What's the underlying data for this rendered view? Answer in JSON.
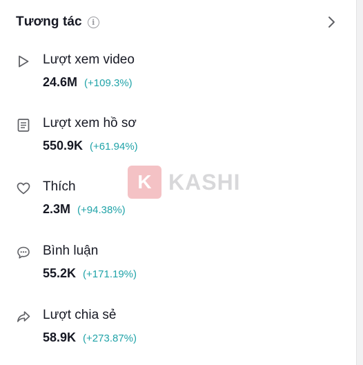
{
  "header": {
    "title": "Tương tác",
    "info_icon": "info-icon",
    "chevron_icon": "chevron-right-icon"
  },
  "metrics": [
    {
      "icon": "play-icon",
      "label": "Lượt xem video",
      "value": "24.6M",
      "change": "(+109.3%)"
    },
    {
      "icon": "profile-document-icon",
      "label": "Lượt xem hồ sơ",
      "value": "550.9K",
      "change": "(+61.94%)"
    },
    {
      "icon": "heart-icon",
      "label": "Thích",
      "value": "2.3M",
      "change": "(+94.38%)"
    },
    {
      "icon": "comment-icon",
      "label": "Bình luận",
      "value": "55.2K",
      "change": "(+171.19%)"
    },
    {
      "icon": "share-icon",
      "label": "Lượt chia sẻ",
      "value": "58.9K",
      "change": "(+273.87%)"
    }
  ],
  "watermark": {
    "badge": "K",
    "text": "KASHI"
  },
  "colors": {
    "text": "#161823",
    "change": "#20a3a8",
    "icon": "#5f6065",
    "watermark_badge": "#e87a80"
  }
}
